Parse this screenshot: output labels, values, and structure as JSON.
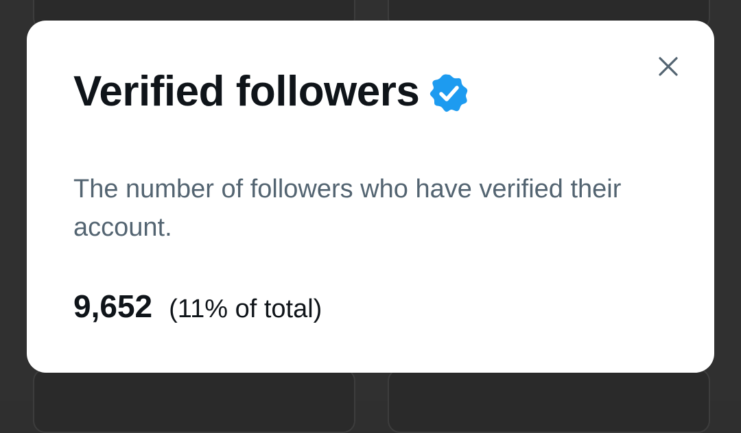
{
  "modal": {
    "title": "Verified followers",
    "description": "The number of followers who have verified their account.",
    "stat_value": "9,652",
    "stat_percent": "(11% of total)"
  },
  "icons": {
    "close": "close-icon",
    "verified": "verified-badge-icon"
  },
  "colors": {
    "verified_blue": "#1d9bf0",
    "title_text": "#0f1419",
    "secondary_text": "#536471",
    "backdrop": "#303030"
  }
}
